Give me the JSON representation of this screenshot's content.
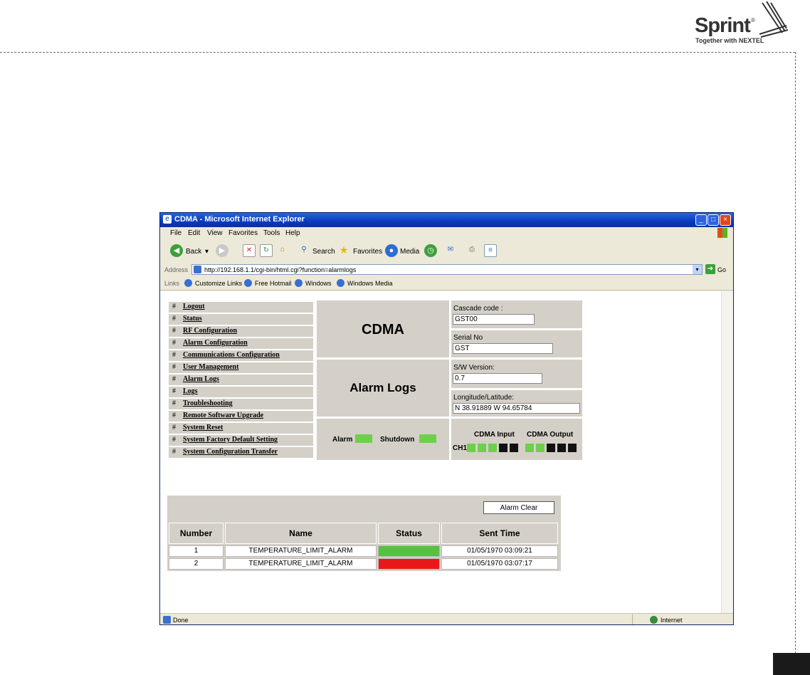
{
  "logo": {
    "brand": "Sprint",
    "reg": "®",
    "tagline": "Together with NEXTEL"
  },
  "window": {
    "title": "CDMA - Microsoft Internet Explorer",
    "min": "_",
    "max": "□",
    "close": "×"
  },
  "menu": [
    "File",
    "Edit",
    "View",
    "Favorites",
    "Tools",
    "Help"
  ],
  "toolbar": {
    "back": "Back",
    "search": "Search",
    "favorites": "Favorites",
    "media": "Media"
  },
  "address": {
    "label": "Address",
    "url": "http://192.168.1.1/cgi-bin/html.cgi?function=alarmlogs",
    "go": "Go"
  },
  "links": {
    "label": "Links",
    "items": [
      "Customize Links",
      "Free Hotmail",
      "Windows",
      "Windows Media"
    ]
  },
  "nav": {
    "hash": "#",
    "items": [
      "Logout",
      "Status",
      "RF Configuration",
      "Alarm Configuration",
      "Communications Configuration",
      "User Management",
      "Alarm Logs",
      "Logs",
      "Troubleshooting",
      "Remote Software Upgrade",
      "System Reset",
      "System Factory Default Setting",
      "System Configuration Transfer"
    ]
  },
  "header": {
    "product": "CDMA",
    "page": "Alarm Logs",
    "cascade_label": "Cascade code :",
    "cascade_value": "GST00",
    "serial_label": "Serial No",
    "serial_value": "GST",
    "sw_label": "S/W Version:",
    "sw_value": "0.7",
    "geo_label": "Longitude/Latitude:",
    "geo_value": "N 38.91889 W 94.65784",
    "alarm_label": "Alarm",
    "shutdown_label": "Shutdown",
    "cdma_input_label": "CDMA Input",
    "cdma_output_label": "CDMA Output",
    "ch_label": "CH1"
  },
  "alarm_table": {
    "clear_label": "Alarm Clear",
    "columns": [
      "Number",
      "Name",
      "Status",
      "Sent Time"
    ],
    "rows": [
      {
        "number": "1",
        "name": "TEMPERATURE_LIMIT_ALARM",
        "status_color": "#55c23b",
        "sent_time": "01/05/1970 03:09:21"
      },
      {
        "number": "2",
        "name": "TEMPERATURE_LIMIT_ALARM",
        "status_color": "#e81818",
        "sent_time": "01/05/1970 03:07:17"
      }
    ]
  },
  "statusbar": {
    "left": "Done",
    "right": "Internet"
  },
  "colors": {
    "led_on": "#6ed04a",
    "led_off": "#111111",
    "titlebar": "#0a3bbf"
  }
}
